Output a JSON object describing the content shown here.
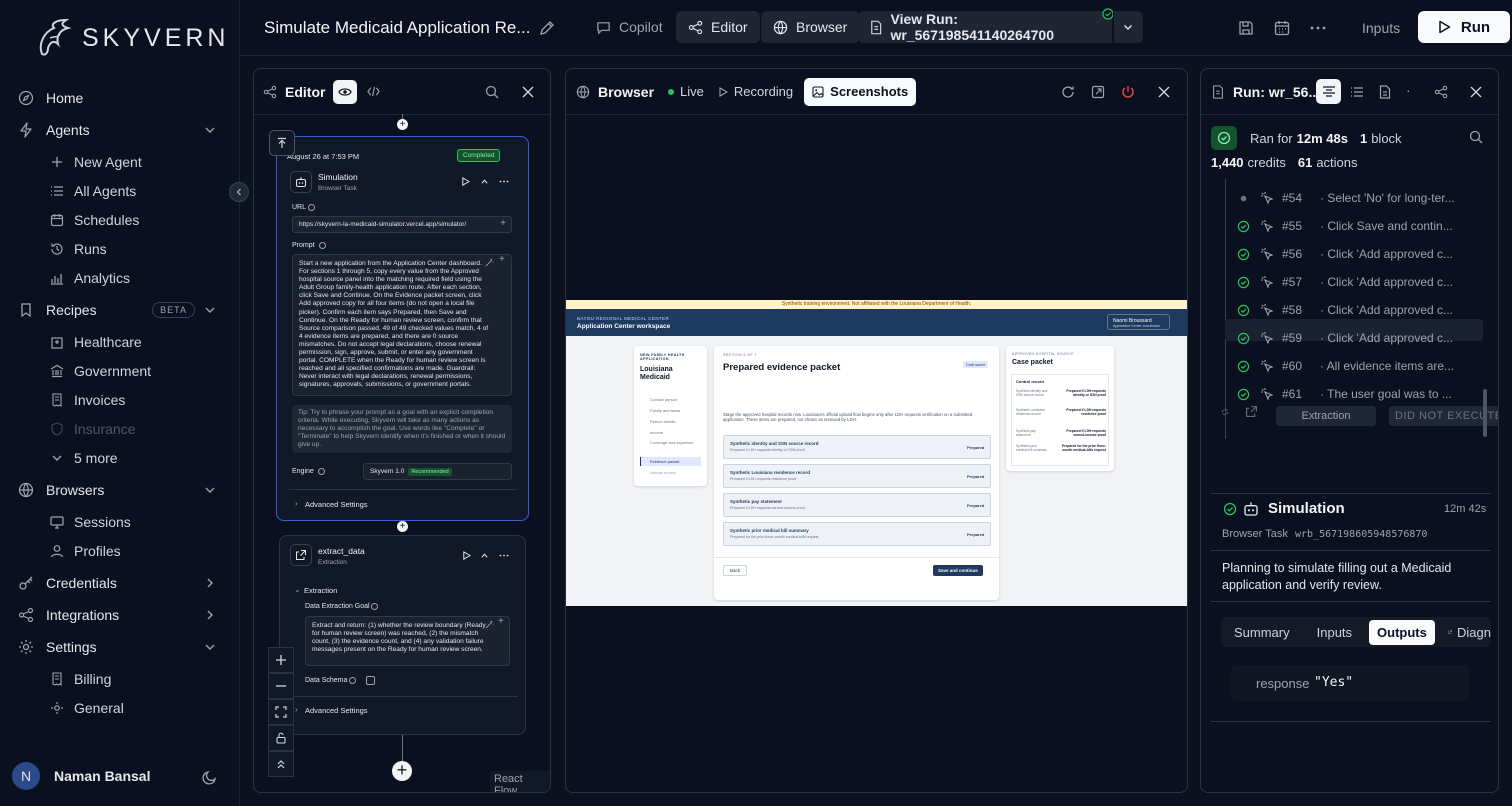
{
  "brand": {
    "name": "SKYVERN"
  },
  "sidebar": {
    "home": "Home",
    "agents": "Agents",
    "agents_items": [
      "New Agent",
      "All Agents",
      "Schedules",
      "Runs",
      "Analytics"
    ],
    "recipes": "Recipes",
    "recipes_badge": "BETA",
    "recipes_items": [
      "Healthcare",
      "Government",
      "Invoices",
      "Insurance",
      "5 more"
    ],
    "browsers": "Browsers",
    "browsers_items": [
      "Sessions",
      "Profiles"
    ],
    "credentials": "Credentials",
    "integrations": "Integrations",
    "settings": "Settings",
    "settings_items": [
      "Billing",
      "General"
    ],
    "user_initial": "N",
    "user_name": "Naman Bansal"
  },
  "topbar": {
    "title": "Simulate Medicaid Application Re...",
    "copilot": "Copilot",
    "editor": "Editor",
    "browser": "Browser",
    "view_run": "View Run: wr_567198541140264700",
    "inputs": "Inputs",
    "run": "Run"
  },
  "editor": {
    "title": "Editor",
    "node1": {
      "timestamp": "August 26 at 7:53 PM",
      "status": "Completed",
      "name": "Simulation",
      "type": "Browser Task",
      "url_label": "URL",
      "url": "https://skyvern-la-medicaid-simulator.vercel.app/simulator/",
      "prompt_label": "Prompt",
      "prompt": "Start a new application from the Application Center dashboard. For sections 1 through 5, copy every value from the Approved hospital source panel into the matching required field using the Adult Group family-health application route. After each section, click Save and Continue. On the Evidence packet screen, click Add approved copy for all four items (do not open a local file picker). Confirm each item says Prepared, then Save and Continue. On the Ready for human review screen, confirm that Source comparison passed, 49 of 49 checked values match, 4 of 4 evidence items are prepared, and there are 0 source mismatches. Do not accept legal declarations, choose renewal permission, sign, approve, submit, or enter any government portal. COMPLETE when the Ready for human review screen is reached and all specified confirmations are made. Guardrail: Never interact with legal declarations, renewal permissions, signatures, approvals, submissions, or government portals.",
      "tip": "Tip: Try to phrase your prompt as a goal with an explicit completion criteria. While executing, Skyvern will take as many actions as necessary to accomplish the goal. Use words like \"Complete\" or \"Terminate\" to help Skyvern identify when it's finished or when it should give up.",
      "engine_label": "Engine",
      "engine": "Skyvern 1.0",
      "engine_badge": "Recommended",
      "advanced": "Advanced Settings"
    },
    "node2": {
      "name": "extract_data",
      "type": "Extraction",
      "section": "Extraction",
      "goal_label": "Data Extraction Goal",
      "goal": "Extract and return: (1) whether the review boundary (Ready for human review screen) was reached, (2) the mismatch count, (3) the evidence count, and (4) any validation failure messages present on the Ready for human review screen.",
      "schema_label": "Data Schema",
      "advanced": "Advanced Settings"
    },
    "react_flow": "React Flow"
  },
  "browser": {
    "title": "Browser",
    "live": "Live",
    "recording": "Recording",
    "screenshots": "Screenshots",
    "shot": {
      "banner": "Synthetic training environment. Not affiliated with the Louisiana Department of Health.",
      "org": "BAYOU REGIONAL MEDICAL CENTER",
      "workspace": "Application Center workspace",
      "user_name": "Naomi Broussard",
      "user_role": "Application Center coordinator",
      "app_kicker": "NEW FAMILY HEALTH APPLICATION",
      "app_title": "Louisiana Medicaid",
      "steps": [
        "Contact person",
        "Family and taxes",
        "Person details",
        "Income",
        "Coverage and expenses",
        "Evidence packet",
        "Human review"
      ],
      "section_kicker": "SECTION 6 OF 7",
      "section_title": "Prepared evidence packet",
      "draft": "Draft saved",
      "section_desc": "Stage the approved hospital records now. Louisiana's official upload flow begins only after LDH requests verification on a submitted application. These items are prepared, not shown as received by LDH.",
      "items": [
        {
          "title": "Synthetic identity and SSN source record",
          "sub": "Prepared if LDH requests identity or SSN proof",
          "status": "Prepared"
        },
        {
          "title": "Synthetic Louisiana residence record",
          "sub": "Prepared if LDH requests residence proof",
          "status": "Prepared"
        },
        {
          "title": "Synthetic pay statement",
          "sub": "Prepared if LDH requests earned-income proof",
          "status": "Prepared"
        },
        {
          "title": "Synthetic prior medical bill summary",
          "sub": "Prepared for the prior-three-month medical-bills request",
          "status": "Prepared"
        }
      ],
      "back": "Back",
      "save": "Save and continue",
      "source_kicker": "APPROVED HOSPITAL SOURCE",
      "source_title": "Case packet",
      "control": "Control record",
      "source_rows": [
        {
          "k": "Synthetic identity and SSN source record",
          "v": "Prepared if LDH requests identity or SSN proof"
        },
        {
          "k": "Synthetic Louisiana residence record",
          "v": "Prepared if LDH requests residence proof"
        },
        {
          "k": "Synthetic pay statement",
          "v": "Prepared if LDH requests earned-income proof"
        },
        {
          "k": "Synthetic prior medical bill summary",
          "v": "Prepared for the prior three-month medical-bills request"
        }
      ]
    }
  },
  "run": {
    "title": "Run: wr_56...",
    "ran_for_label": "Ran for",
    "duration": "12m 48s",
    "blocks": "1",
    "blocks_label": "block",
    "credits": "1,440",
    "credits_label": "credits",
    "actions": "61",
    "actions_label": "actions",
    "steps": [
      {
        "num": "#54",
        "text": "· Select 'No' for long-ter...",
        "state": "pending"
      },
      {
        "num": "#55",
        "text": "· Click Save and contin...",
        "state": "done"
      },
      {
        "num": "#56",
        "text": "· Click 'Add approved c...",
        "state": "done"
      },
      {
        "num": "#57",
        "text": "· Click 'Add approved c...",
        "state": "done"
      },
      {
        "num": "#58",
        "text": "· Click 'Add approved c...",
        "state": "done"
      },
      {
        "num": "#59",
        "text": "· Click 'Add approved c...",
        "state": "done"
      },
      {
        "num": "#60",
        "text": "· All evidence items are...",
        "state": "done"
      },
      {
        "num": "#61",
        "text": "· The user goal was to ...",
        "state": "done"
      }
    ],
    "extraction": "Extraction",
    "did_not_execute": "DID NOT EXECUTE",
    "block_name": "Simulation",
    "block_time": "12m 42s",
    "block_type": "Browser Task",
    "block_id": "wrb_567198605948576870",
    "block_desc": "Planning to simulate filling out a Medicaid application and verify review.",
    "tabs": [
      "Summary",
      "Inputs",
      "Outputs",
      "Diagn"
    ],
    "response_key": "response",
    "response_val": "\"Yes\""
  }
}
